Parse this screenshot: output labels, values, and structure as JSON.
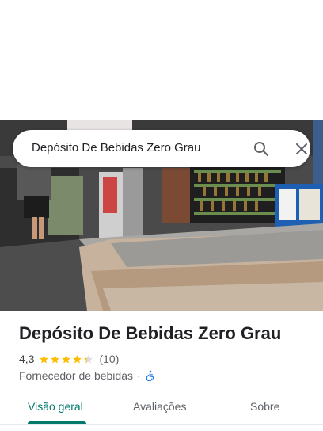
{
  "search": {
    "query": "Depósito De Bebidas Zero Grau",
    "search_icon": "search-icon",
    "close_icon": "close-icon"
  },
  "hero_image": {
    "description_icon": "storefront-photo"
  },
  "place": {
    "name": "Depósito De Bebidas Zero Grau",
    "rating": "4,3",
    "rating_value": 4.3,
    "stars_max": 5,
    "review_count": "(10)",
    "category": "Fornecedor de bebidas",
    "separator": "·",
    "accessibility_icon": "wheelchair-icon"
  },
  "tabs": [
    {
      "label": "Visão geral",
      "active": true
    },
    {
      "label": "Avaliações",
      "active": false
    },
    {
      "label": "Sobre",
      "active": false
    }
  ],
  "colors": {
    "accent": "#00796b",
    "star": "#fbbc04",
    "wheelchair": "#1a73e8"
  }
}
